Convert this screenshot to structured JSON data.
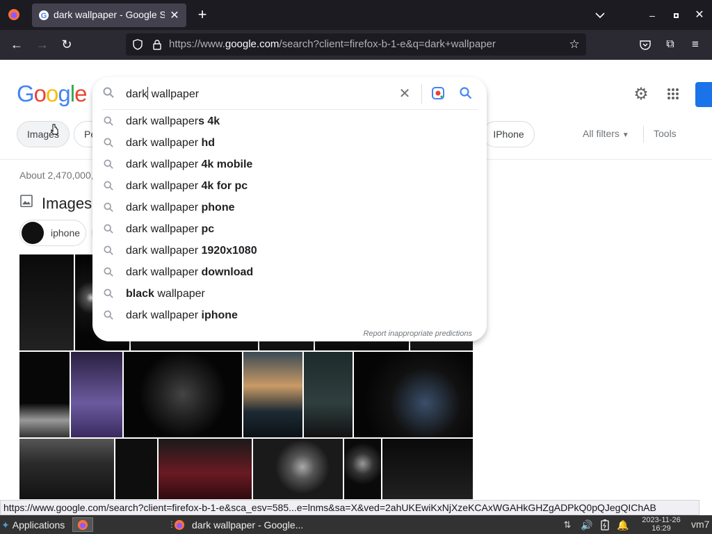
{
  "browser": {
    "tab_title": "dark wallpaper - Google Search",
    "url_prefix": "https://www.",
    "url_domain": "google.com",
    "url_rest": "/search?client=firefox-b-1-e&q=dark+wallpaper",
    "new_tab": "+",
    "status_url": "https://www.google.com/search?client=firefox-b-1-e&sca_esv=585...e=lnms&sa=X&ved=2ahUKEwiKxNjXzeKCAxWGAHkGHZgADPkQ0pQJegQIChAB"
  },
  "google": {
    "logo": "Google",
    "search_query_before": "dark",
    "search_query_after": " wallpaper",
    "result_count": "About 2,470,000,",
    "images_heading": "Images",
    "chips": [
      "Images",
      "Pe",
      "IPhone"
    ],
    "all_filters": "All filters",
    "tools": "Tools",
    "filter_chip": "iphone",
    "report": "Report inappropriate predictions"
  },
  "suggestions": [
    {
      "plain": "dark wallpaper",
      "bold": "s 4k"
    },
    {
      "plain": "dark wallpaper ",
      "bold": "hd"
    },
    {
      "plain": "dark wallpaper ",
      "bold": "4k mobile"
    },
    {
      "plain": "dark wallpaper ",
      "bold": "4k for pc"
    },
    {
      "plain": "dark wallpaper ",
      "bold": "phone"
    },
    {
      "plain": "dark wallpaper ",
      "bold": "pc"
    },
    {
      "plain": "dark wallpaper ",
      "bold": "1920x1080"
    },
    {
      "plain": "dark wallpaper ",
      "bold": "download"
    },
    {
      "bold_first": "black",
      "plain": " wallpaper"
    },
    {
      "plain": "dark wallpaper ",
      "bold": "iphone"
    }
  ],
  "taskbar": {
    "applications": "Applications",
    "window_title": "dark wallpaper - Google...",
    "date": "2023-11-26",
    "time": "16:29",
    "host": "vm7"
  },
  "colors": {
    "google_blue": "#4285f4",
    "google_red": "#ea4335",
    "google_yellow": "#fbbc05",
    "google_green": "#34a853"
  }
}
